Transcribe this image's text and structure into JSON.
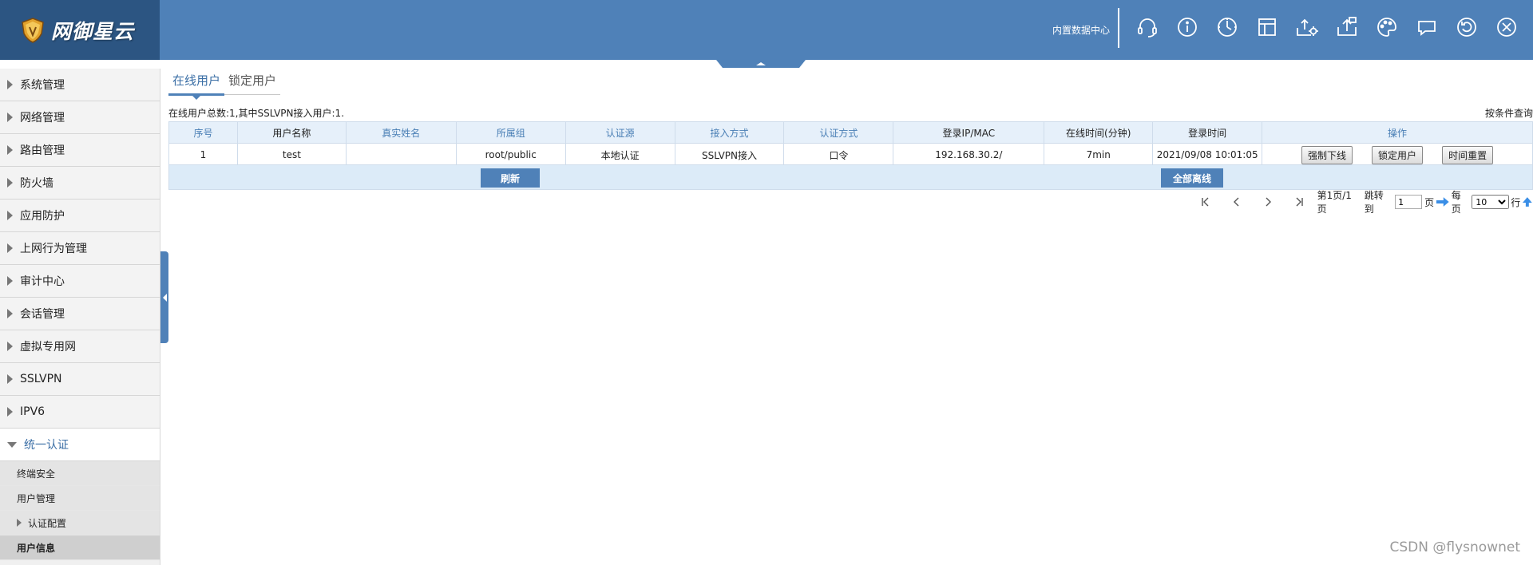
{
  "header": {
    "logo_text": "网御星云",
    "data_center_link": "内置数据中心",
    "icons": [
      {
        "name": "headset-icon"
      },
      {
        "name": "info-icon"
      },
      {
        "name": "clock-icon"
      },
      {
        "name": "layout-icon"
      },
      {
        "name": "export-settings-icon"
      },
      {
        "name": "upload-icon"
      },
      {
        "name": "palette-icon"
      },
      {
        "name": "chat-icon"
      },
      {
        "name": "refresh-icon"
      },
      {
        "name": "close-icon"
      }
    ]
  },
  "sidebar": {
    "items": [
      {
        "label": "系统管理"
      },
      {
        "label": "网络管理"
      },
      {
        "label": "路由管理"
      },
      {
        "label": "防火墙"
      },
      {
        "label": "应用防护"
      },
      {
        "label": "上网行为管理"
      },
      {
        "label": "审计中心"
      },
      {
        "label": "会话管理"
      },
      {
        "label": "虚拟专用网"
      },
      {
        "label": "SSLVPN"
      },
      {
        "label": "IPV6"
      },
      {
        "label": "统一认证"
      }
    ],
    "sub_items": [
      {
        "label": "终端安全"
      },
      {
        "label": "用户管理"
      },
      {
        "label": "认证配置"
      },
      {
        "label": "用户信息"
      }
    ]
  },
  "tabs": [
    {
      "label": "在线用户"
    },
    {
      "label": "锁定用户"
    }
  ],
  "summary": "在线用户总数:1,其中SSLVPN接入用户:1.",
  "search_link": "按条件查询",
  "table": {
    "headers": [
      "序号",
      "用户名称",
      "真实姓名",
      "所属组",
      "认证源",
      "接入方式",
      "认证方式",
      "登录IP/MAC",
      "在线时间(分钟)",
      "登录时间",
      "操作"
    ],
    "rows": [
      {
        "cells": [
          "1",
          "test",
          "",
          "root/public",
          "本地认证",
          "SSLVPN接入",
          "口令",
          "192.168.30.2/",
          "7min",
          "2021/09/08 10:01:05"
        ],
        "actions": [
          "强制下线",
          "锁定用户",
          "时间重置"
        ]
      }
    ]
  },
  "actions": {
    "refresh": "刷新",
    "all_offline": "全部离线"
  },
  "pager": {
    "page_info": "第1页/1页",
    "jump_label": "跳转到",
    "page_value": "1",
    "page_unit": "页",
    "per_page_label": "每页",
    "per_page_value": "10",
    "row_unit": "行"
  },
  "watermark": "CSDN @flysnownet"
}
